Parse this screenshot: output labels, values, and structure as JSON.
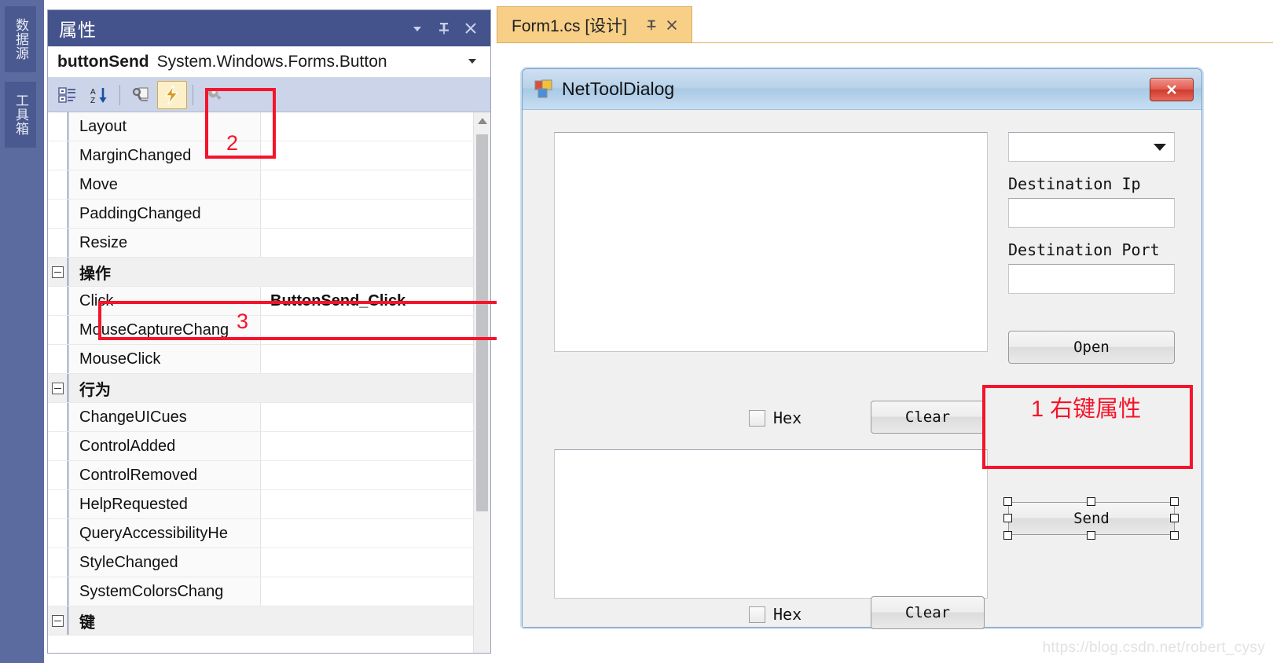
{
  "dock": {
    "tabs": [
      {
        "label": "数据源",
        "name": "dock-tab-datasource"
      },
      {
        "label": "工具箱",
        "name": "dock-tab-toolbox"
      }
    ]
  },
  "properties_window": {
    "title": "属性",
    "title_buttons": [
      {
        "icon": "chevron-down-icon",
        "label": "▾"
      },
      {
        "icon": "pin-icon",
        "label": "⊥"
      },
      {
        "icon": "close-icon",
        "label": "✕"
      }
    ],
    "object_name": "buttonSend",
    "object_type": "System.Windows.Forms.Button",
    "object_dropdown_caret": "▾",
    "toolbar": {
      "categorized_tooltip": "分类",
      "alphabetical_tooltip": "字母序",
      "properties_tooltip": "属性",
      "events_tooltip": "事件",
      "property_pages_tooltip": "属性页",
      "active_button": "events"
    },
    "grid": {
      "rows": [
        {
          "type": "prop",
          "name": "Layout",
          "value": ""
        },
        {
          "type": "prop",
          "name": "MarginChanged",
          "value": ""
        },
        {
          "type": "prop",
          "name": "Move",
          "value": ""
        },
        {
          "type": "prop",
          "name": "PaddingChanged",
          "value": ""
        },
        {
          "type": "prop",
          "name": "Resize",
          "value": ""
        },
        {
          "type": "category",
          "name": "操作",
          "value": ""
        },
        {
          "type": "prop",
          "name": "Click",
          "value": "ButtonSend_Click",
          "bold": true
        },
        {
          "type": "prop",
          "name": "MouseCaptureChang",
          "value": ""
        },
        {
          "type": "prop",
          "name": "MouseClick",
          "value": ""
        },
        {
          "type": "category",
          "name": "行为",
          "value": ""
        },
        {
          "type": "prop",
          "name": "ChangeUICues",
          "value": ""
        },
        {
          "type": "prop",
          "name": "ControlAdded",
          "value": ""
        },
        {
          "type": "prop",
          "name": "ControlRemoved",
          "value": ""
        },
        {
          "type": "prop",
          "name": "HelpRequested",
          "value": ""
        },
        {
          "type": "prop",
          "name": "QueryAccessibilityHe",
          "value": ""
        },
        {
          "type": "prop",
          "name": "StyleChanged",
          "value": ""
        },
        {
          "type": "prop",
          "name": "SystemColorsChang",
          "value": ""
        },
        {
          "type": "category",
          "name": "键",
          "value": ""
        }
      ]
    }
  },
  "designer": {
    "tab_label": "Form1.cs [设计]",
    "tab_pin_icon": "⊥",
    "tab_close_icon": "✕",
    "dialog": {
      "title": "NetToolDialog",
      "close_label": "✕",
      "combobox_value": "",
      "labels": {
        "destination_ip": "Destination Ip",
        "destination_port": "Destination Port"
      },
      "buttons": {
        "open": "Open",
        "clear_top": "Clear",
        "clear_bottom": "Clear",
        "send": "Send"
      },
      "checkboxes": {
        "hex_top": "Hex",
        "hex_bottom": "Hex"
      },
      "textbox_receive_value": "",
      "textbox_send_value": "",
      "ip_value": "",
      "port_value": ""
    }
  },
  "annotations": {
    "step1": "1 右键属性",
    "step2": "2",
    "step3": "3"
  },
  "watermark": "https://blog.csdn.net/robert_cysy",
  "colors": {
    "accent_blue": "#44538c",
    "annotation_red": "#f5142a",
    "tab_orange": "#f7cf87",
    "toolbar_blue": "#ccd4ea"
  }
}
